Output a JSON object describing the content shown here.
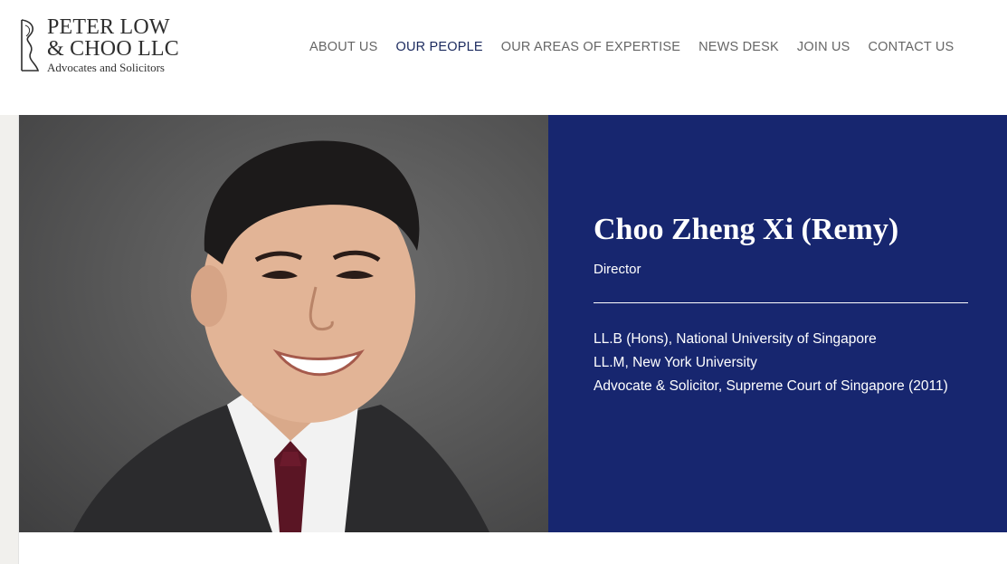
{
  "header": {
    "logo": {
      "line1": "PETER LOW",
      "line2": "& CHOO LLC",
      "line3": "Advocates and Solicitors"
    },
    "nav": [
      {
        "label": "ABOUT US",
        "active": false
      },
      {
        "label": "OUR PEOPLE",
        "active": true
      },
      {
        "label": "OUR AREAS OF EXPERTISE",
        "active": false
      },
      {
        "label": "NEWS DESK",
        "active": false
      },
      {
        "label": "JOIN US",
        "active": false
      },
      {
        "label": "CONTACT US",
        "active": false
      }
    ]
  },
  "profile": {
    "name": "Choo Zheng Xi (Remy)",
    "role": "Director",
    "qualifications": [
      "LL.B (Hons), National University of Singapore",
      "LL.M, New York University",
      "Advocate & Solicitor, Supreme Court of Singapore (2011)"
    ]
  },
  "colors": {
    "panel": "#17266f",
    "nav_active": "#1b2a5e",
    "nav_default": "#666666"
  }
}
